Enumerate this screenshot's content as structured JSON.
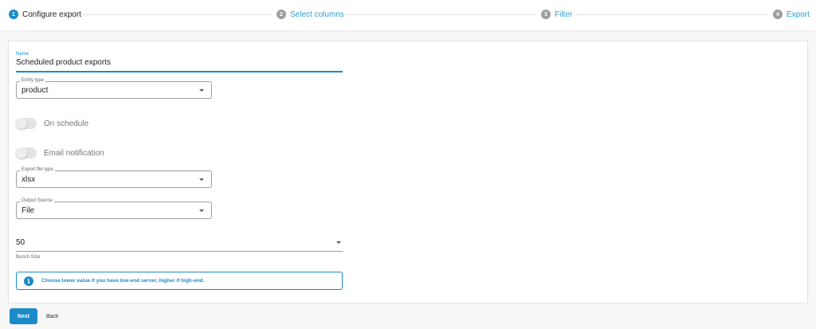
{
  "stepper": {
    "steps": [
      {
        "number": "1",
        "label": "Configure export",
        "state": "active"
      },
      {
        "number": "2",
        "label": "Select columns",
        "state": "inactive"
      },
      {
        "number": "3",
        "label": "Filter",
        "state": "inactive"
      },
      {
        "number": "4",
        "label": "Export",
        "state": "inactive"
      }
    ]
  },
  "form": {
    "name": {
      "label": "Name",
      "value": "Scheduled product exports"
    },
    "entity_type": {
      "label": "Entity type",
      "value": "product"
    },
    "on_schedule": {
      "label": "On schedule",
      "checked": false
    },
    "email_notification": {
      "label": "Email notification",
      "checked": false
    },
    "export_file_type": {
      "label": "Export file type",
      "value": "xlsx"
    },
    "output_source": {
      "label": "Output Source",
      "value": "File"
    },
    "bunch_size": {
      "value": "50",
      "helper": "Bunch Size"
    },
    "info": {
      "icon": "info-icon",
      "text": "Choose lower value if you have low-end server, higher if high-end."
    }
  },
  "footer": {
    "next_label": "Next",
    "back_label": "Back"
  },
  "colors": {
    "accent": "#1b8bc7",
    "link": "#2a9fd6",
    "inactive_step": "#9e9e9e"
  }
}
